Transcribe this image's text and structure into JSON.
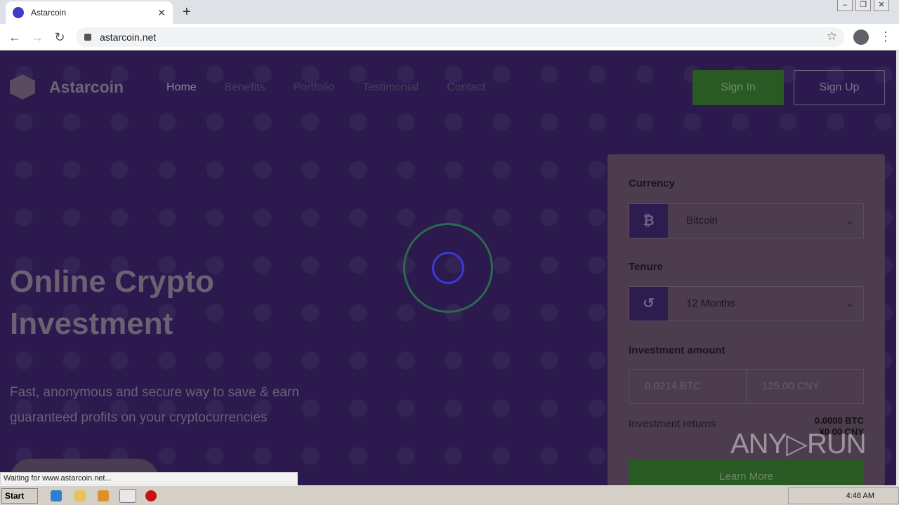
{
  "browser": {
    "tab_title": "Astarcoin",
    "url": "astarcoin.net",
    "status": "Waiting for www.astarcoin.net..."
  },
  "site": {
    "brand": "Astarcoin",
    "nav": [
      "Home",
      "Benefits",
      "Portfolio",
      "Testimonial",
      "Contact"
    ],
    "signin": "Sign In",
    "signup": "Sign Up",
    "hero_title": "Online Crypto Investment",
    "hero_sub": "Fast, anonymous and secure way to save & earn guaranteed profits on your cryptocurrencies"
  },
  "calculator": {
    "currency_label": "Currency",
    "currency_value": "Bitcoin",
    "currency_icon": "₿",
    "tenure_label": "Tenure",
    "tenure_value": "12 Months",
    "amount_label": "Investment amount",
    "amount_btc": "0.0214 BTC",
    "amount_cny": "125.00 CNY",
    "returns_label": "Investment returns",
    "returns_btc": "0.0000 BTC",
    "returns_cny": "¥0.00 CNY",
    "learn_more": "Learn More"
  },
  "taskbar": {
    "start": "Start",
    "time": "4:46 AM"
  },
  "watermark": "ANY▷RUN"
}
